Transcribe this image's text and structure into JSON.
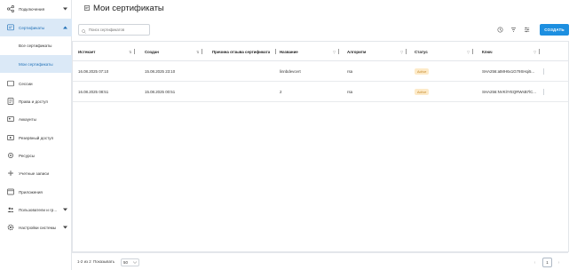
{
  "sidebar": {
    "items": [
      {
        "label": "Подключения",
        "icon": "share-icon"
      },
      {
        "label": "Сертификаты",
        "icon": "certificate-icon"
      },
      {
        "label": "Сессии",
        "icon": "session-icon"
      },
      {
        "label": "Права и доступ",
        "icon": "rights-icon"
      },
      {
        "label": "Аккаунты",
        "icon": "accounts-icon"
      },
      {
        "label": "Резервный доступ",
        "icon": "backup-access-icon"
      },
      {
        "label": "Ресурсы",
        "icon": "resources-icon"
      },
      {
        "label": "Учетные записи",
        "icon": "records-icon"
      },
      {
        "label": "Приложения",
        "icon": "apps-icon"
      },
      {
        "label": "Пользователи и гр...",
        "icon": "users-icon"
      },
      {
        "label": "Настройки системы",
        "icon": "settings-icon"
      }
    ],
    "subitems": [
      "Все сертификаты",
      "Мои сертификаты"
    ]
  },
  "header": {
    "title": "Мои сертификаты",
    "search_placeholder": "Поиск сертификатов",
    "create_label": "СОЗДАТЬ"
  },
  "table": {
    "columns": [
      "Истекает",
      "Создан",
      "Причина отзыва сертификата",
      "Название",
      "Алгоритм",
      "Статус",
      "Ключ"
    ],
    "rows": [
      {
        "expires": "16.08.2025 07:10",
        "created": "15.08.2025 23:10",
        "reason": "",
        "name": "linnbdevcert",
        "algo": "rsa",
        "status": "Active",
        "key": "SHA256:atMH6x1G79SHqi5..."
      },
      {
        "expires": "16.08.2025 08:51",
        "created": "15.08.2025 00:51",
        "reason": "",
        "name": "2",
        "algo": "rsa",
        "status": "Active",
        "key": "SHA256:NVKlrYEQRWsB7lC..."
      }
    ]
  },
  "footer": {
    "range": "1-2 из 2",
    "per_page_label": "Показывать",
    "per_page": "50",
    "page": "1"
  },
  "colors": {
    "accent": "#1d8fe0",
    "active_bg": "#dbe9f7",
    "badge_bg": "#fdeac8"
  }
}
